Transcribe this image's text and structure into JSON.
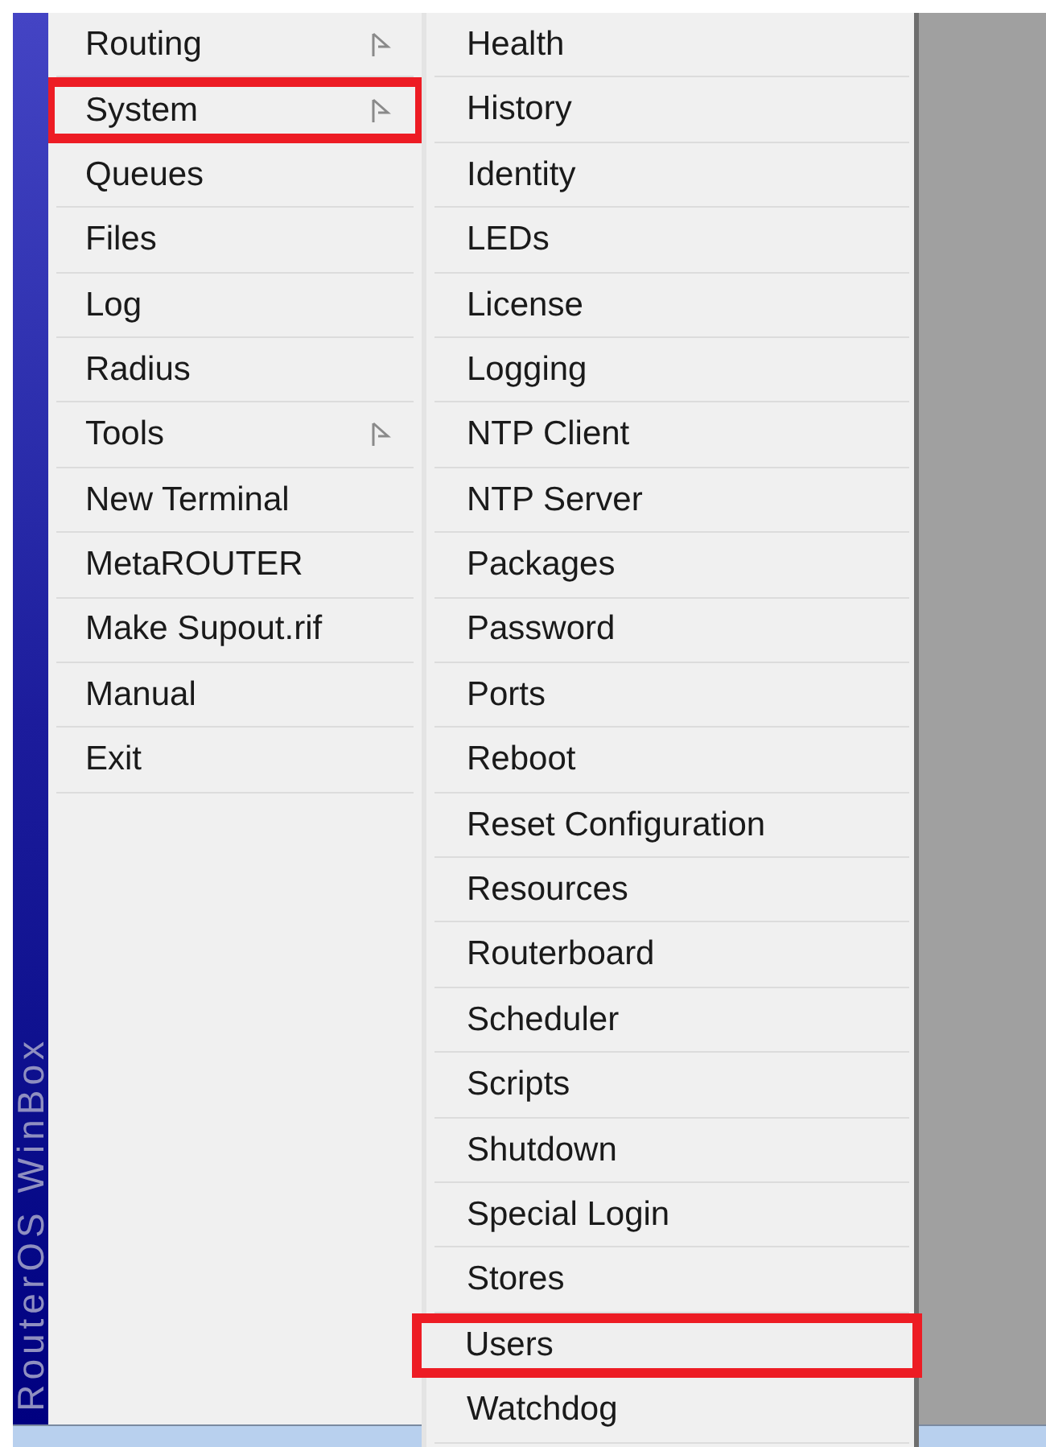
{
  "sidebar_label": "RouterOS WinBox",
  "main_menu": [
    {
      "label": "Routing",
      "has_submenu": true,
      "highlighted": false
    },
    {
      "label": "System",
      "has_submenu": true,
      "highlighted": true
    },
    {
      "label": "Queues",
      "has_submenu": false,
      "highlighted": false
    },
    {
      "label": "Files",
      "has_submenu": false,
      "highlighted": false
    },
    {
      "label": "Log",
      "has_submenu": false,
      "highlighted": false
    },
    {
      "label": "Radius",
      "has_submenu": false,
      "highlighted": false
    },
    {
      "label": "Tools",
      "has_submenu": true,
      "highlighted": false
    },
    {
      "label": "New Terminal",
      "has_submenu": false,
      "highlighted": false
    },
    {
      "label": "MetaROUTER",
      "has_submenu": false,
      "highlighted": false
    },
    {
      "label": "Make Supout.rif",
      "has_submenu": false,
      "highlighted": false
    },
    {
      "label": "Manual",
      "has_submenu": false,
      "highlighted": false
    },
    {
      "label": "Exit",
      "has_submenu": false,
      "highlighted": false
    }
  ],
  "submenu": [
    {
      "label": "Health",
      "highlighted": false
    },
    {
      "label": "History",
      "highlighted": false
    },
    {
      "label": "Identity",
      "highlighted": false
    },
    {
      "label": "LEDs",
      "highlighted": false
    },
    {
      "label": "License",
      "highlighted": false
    },
    {
      "label": "Logging",
      "highlighted": false
    },
    {
      "label": "NTP Client",
      "highlighted": false
    },
    {
      "label": "NTP Server",
      "highlighted": false
    },
    {
      "label": "Packages",
      "highlighted": false
    },
    {
      "label": "Password",
      "highlighted": false
    },
    {
      "label": "Ports",
      "highlighted": false
    },
    {
      "label": "Reboot",
      "highlighted": false
    },
    {
      "label": "Reset Configuration",
      "highlighted": false
    },
    {
      "label": "Resources",
      "highlighted": false
    },
    {
      "label": "Routerboard",
      "highlighted": false
    },
    {
      "label": "Scheduler",
      "highlighted": false
    },
    {
      "label": "Scripts",
      "highlighted": false
    },
    {
      "label": "Shutdown",
      "highlighted": false
    },
    {
      "label": "Special Login",
      "highlighted": false
    },
    {
      "label": "Stores",
      "highlighted": false
    },
    {
      "label": "Users",
      "highlighted": true
    },
    {
      "label": "Watchdog",
      "highlighted": false
    }
  ]
}
